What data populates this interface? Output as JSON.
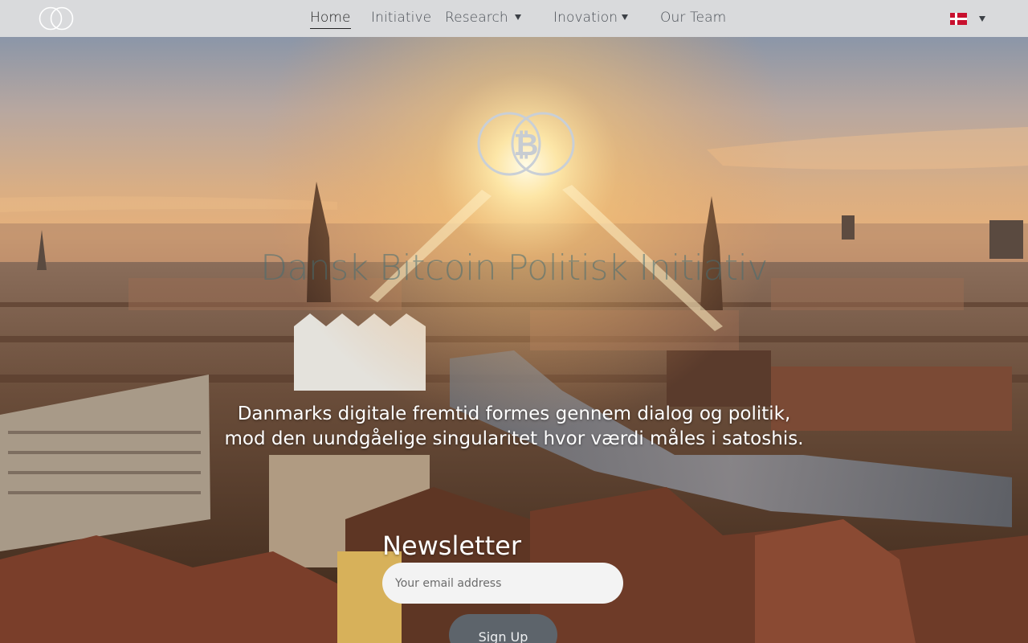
{
  "nav": {
    "items": [
      {
        "label": "Home",
        "active": true
      },
      {
        "label": "Initiative"
      },
      {
        "label": "Research",
        "has_dropdown": true
      },
      {
        "label": "Inovation",
        "has_dropdown": true
      },
      {
        "label": "Our Team"
      }
    ],
    "language": {
      "flag": "denmark-flag-icon",
      "has_dropdown": true
    }
  },
  "hero": {
    "title": "Dansk Bitcoin Politisk Initiativ",
    "tagline_line1": "Danmarks digitale fremtid formes gennem dialog og politik,",
    "tagline_line2": "mod den uundgåelige singularitet hvor værdi måles i satoshis.",
    "logo_symbol": "₿"
  },
  "newsletter": {
    "title": "Newsletter",
    "email_placeholder": "Your email address",
    "email_value": "",
    "button_label": "Sign Up"
  },
  "colors": {
    "nav_bg": "#d9dadc",
    "button_bg": "#5d646b",
    "title_color": "#466e73",
    "flag_red": "#c8102e"
  }
}
